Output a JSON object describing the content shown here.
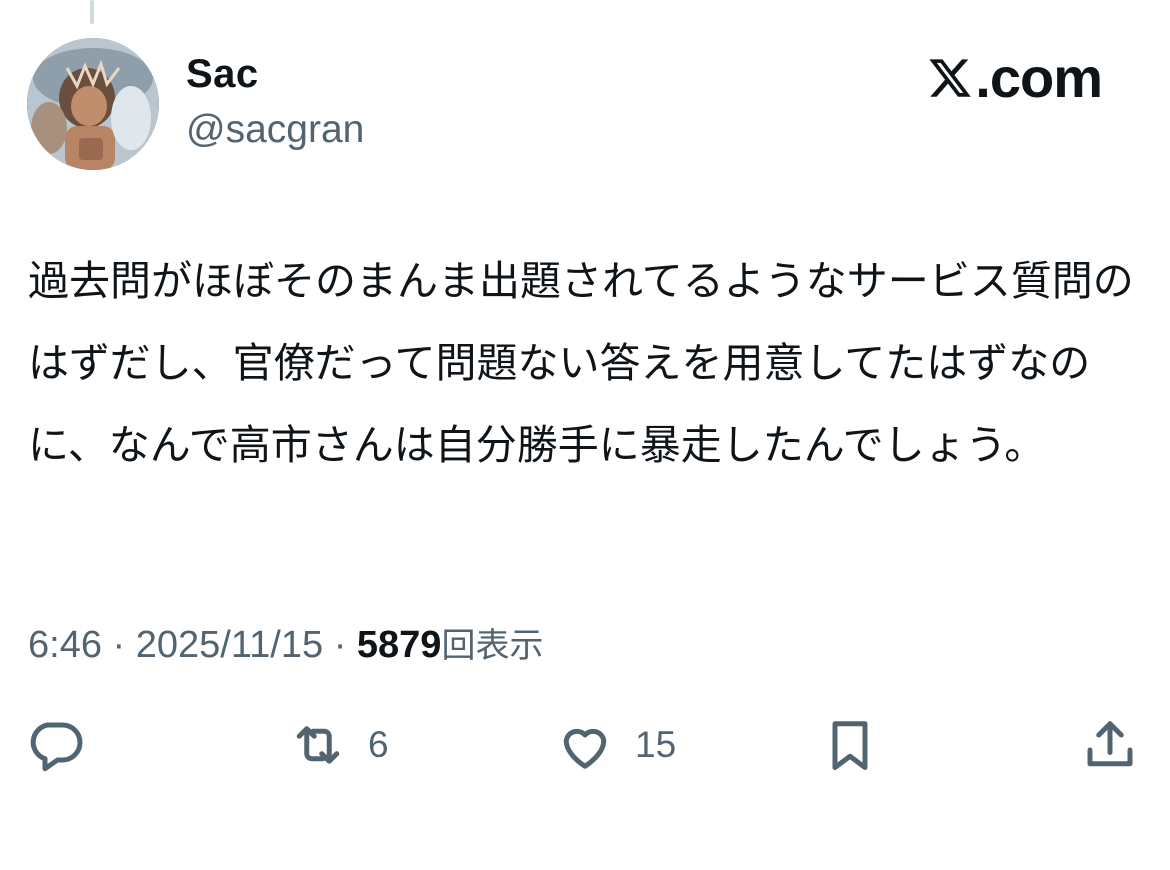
{
  "author": {
    "display_name": "Sac",
    "handle": "@sacgran"
  },
  "brand": {
    "label": ".com"
  },
  "tweet": {
    "text": "過去問がほぼそのまんま出題されてるようなサービス質問のはずだし、官僚だって問題ない答えを用意してたはずなのに、なんで高市さんは自分勝手に暴走したんでしょう。"
  },
  "meta": {
    "time": "6:46",
    "separator": "·",
    "date": "2025/11/15",
    "views_count": "5879",
    "views_label": "回表示"
  },
  "actions": {
    "reply_icon": "reply-icon",
    "retweet_icon": "retweet-icon",
    "retweet_count": "6",
    "like_icon": "heart-icon",
    "like_count": "15",
    "bookmark_icon": "bookmark-icon",
    "share_icon": "share-icon"
  },
  "colors": {
    "text_primary": "#0f1419",
    "text_secondary": "#536471",
    "background": "#ffffff"
  }
}
